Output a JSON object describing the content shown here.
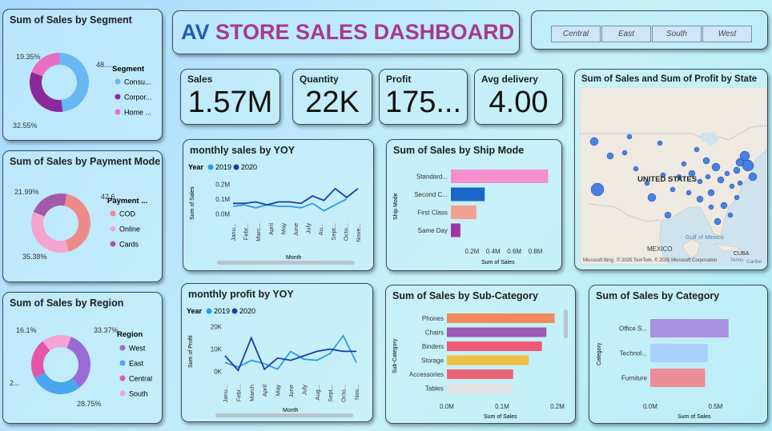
{
  "title": {
    "part1": "AV",
    "part2": "STORE SALES DASHBOARD"
  },
  "slicer": [
    "Central",
    "East",
    "South",
    "West"
  ],
  "colors": {
    "title_blue": "#1f5fb0",
    "title_purple": "#a83890",
    "line_dark": "#1a3aa8",
    "line_light": "#2f9ae8"
  },
  "kpis": [
    {
      "label": "Sales",
      "value": "1.57M"
    },
    {
      "label": "Quantity",
      "value": "22K"
    },
    {
      "label": "Profit",
      "value": "175..."
    },
    {
      "label": "Avg delivery",
      "value": "4.00"
    }
  ],
  "segment": {
    "title": "Sum of Sales by Segment",
    "legend_title": "Segment",
    "labels": [
      "48....",
      "32.55%",
      "19.35%"
    ],
    "chart_data": {
      "type": "pie",
      "categories": [
        "Consu...",
        "Corpor...",
        "Home ..."
      ],
      "values": [
        48.1,
        32.55,
        19.35
      ],
      "colors": [
        "#68b8f2",
        "#8a2a9a",
        "#e96ec0"
      ]
    }
  },
  "payment": {
    "title": "Sum of Sales by Payment Mode",
    "legend_title": "Payment ...",
    "labels": [
      "42.6...",
      "35.38%",
      "21.99%"
    ],
    "chart_data": {
      "type": "pie",
      "categories": [
        "COD",
        "Online",
        "Cards"
      ],
      "values": [
        42.63,
        35.38,
        21.99
      ],
      "colors": [
        "#ef8a8a",
        "#f5a3cf",
        "#a35aa8"
      ]
    }
  },
  "region": {
    "title": "Sum of Sales by Region",
    "legend_title": "Region",
    "labels": [
      "33.37%",
      "28.75%",
      "2...",
      "16.1%"
    ],
    "chart_data": {
      "type": "pie",
      "categories": [
        "West",
        "East",
        "Central",
        "South"
      ],
      "values": [
        33.37,
        28.75,
        21.78,
        16.1
      ],
      "colors": [
        "#9a6ad6",
        "#4aa6ee",
        "#e455a8",
        "#f4a3d4"
      ]
    }
  },
  "monthly_sales": {
    "title": "monthly sales by YOY",
    "legend_title": "Year",
    "ylabel": "Sum of Sales",
    "xlabel": "Month",
    "chart_data": {
      "type": "line",
      "categories": [
        "Janu...",
        "Febr...",
        "Marc...",
        "April",
        "May",
        "June",
        "July",
        "Au...",
        "Sept...",
        "Octo...",
        "Nove..."
      ],
      "series": [
        {
          "name": "2019",
          "values": [
            0.05,
            0.06,
            0.04,
            0.06,
            0.05,
            0.05,
            0.04,
            0.07,
            0.02,
            0.06,
            0.1
          ]
        },
        {
          "name": "2020",
          "values": [
            0.07,
            0.07,
            0.08,
            0.06,
            0.08,
            0.08,
            0.07,
            0.12,
            0.09,
            0.17,
            0.11,
            0.17
          ]
        }
      ],
      "yticks": [
        "0.0M",
        "0.1M",
        "0.2M"
      ],
      "ylim": [
        -0.02,
        0.25
      ]
    }
  },
  "monthly_profit": {
    "title": "monthly profit by YOY",
    "legend_title": "Year",
    "ylabel": "Sum of Profit",
    "xlabel": "Month",
    "chart_data": {
      "type": "line",
      "categories": [
        "Janu...",
        "Febr...",
        "March",
        "April",
        "May",
        "June",
        "July",
        "Aug...",
        "Sept...",
        "Octo...",
        "Nov..."
      ],
      "series": [
        {
          "name": "2019",
          "values": [
            4000,
            2000,
            5000,
            3500,
            1000,
            9000,
            5500,
            5000,
            8000,
            16000,
            4000
          ]
        },
        {
          "name": "2020",
          "values": [
            7000,
            500,
            15000,
            1000,
            6000,
            5000,
            7000,
            9000,
            10000,
            9000,
            9000
          ]
        }
      ],
      "yticks": [
        "0K",
        "10K",
        "20K"
      ],
      "ylim": [
        -3000,
        22000
      ]
    }
  },
  "ship_mode": {
    "title": "Sum of Sales by Ship Mode",
    "ylabel": "Ship Mode",
    "xlabel": "Sum of Sales",
    "chart_data": {
      "type": "bar",
      "categories": [
        "Standard...",
        "Second C...",
        "First Class",
        "Same Day"
      ],
      "values": [
        0.92,
        0.32,
        0.24,
        0.09
      ],
      "colors": [
        "#f48fcf",
        "#1a66c4",
        "#f2a090",
        "#a035a8"
      ],
      "xticks": [
        "0.2M",
        "0.4M",
        "0.6M",
        "0.8M"
      ],
      "xlim": [
        0,
        1.0
      ]
    }
  },
  "state_map": {
    "title": "Sum of Sales and Sum of Profit by State",
    "labels": {
      "us": "UNITED STATES",
      "mexico": "MEXICO",
      "gulf": "Gulf of Mexico",
      "cuba": "CUBA",
      "caribe": "Caribe"
    },
    "attribution": "© 2025 TomTom, © 2025 Microsoft Corporation",
    "terms": "Terms",
    "logo": "Microsoft Bing"
  },
  "sub_category": {
    "title": "Sum of Sales by Sub-Category",
    "ylabel": "Sub-Category",
    "xlabel": "Sum of Sales",
    "chart_data": {
      "type": "bar",
      "categories": [
        "Phones",
        "Chairs",
        "Binders",
        "Storage",
        "Accessories",
        "Tables"
      ],
      "values": [
        0.195,
        0.18,
        0.172,
        0.148,
        0.12,
        0.118
      ],
      "colors": [
        "#f08a5d",
        "#9a5ab6",
        "#f05a78",
        "#f0c040",
        "#ea6478",
        "#e4e4e4"
      ],
      "xticks": [
        "0.0M",
        "0.1M",
        "0.2M"
      ],
      "xlim": [
        0,
        0.2
      ]
    }
  },
  "category": {
    "title": "Sum of Sales by Category",
    "ylabel": "Category",
    "xlabel": "Sum of Sales",
    "chart_data": {
      "type": "bar",
      "categories": [
        "Office S...",
        "Technol...",
        "Furniture"
      ],
      "values": [
        0.6,
        0.44,
        0.42
      ],
      "colors": [
        "#aa92e0",
        "#a8d0f8",
        "#ec8c96"
      ],
      "xticks": [
        "0.0M",
        "0.5M"
      ],
      "xlim": [
        0,
        0.7
      ]
    }
  }
}
